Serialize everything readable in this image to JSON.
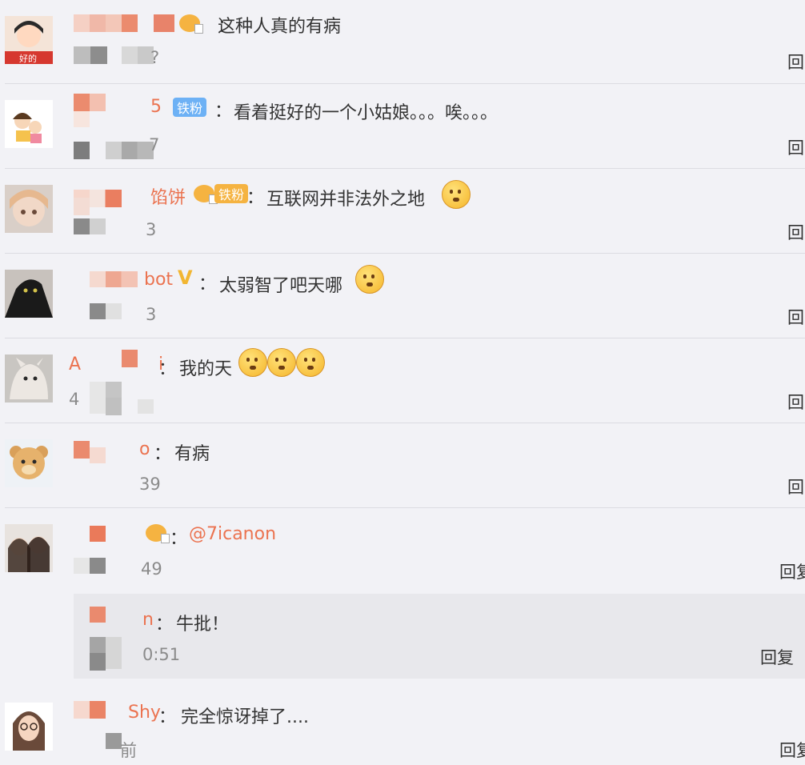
{
  "comments": [
    {
      "name_visible": "",
      "badge": "crown",
      "content": "这种人真的有病",
      "time": "?",
      "reply": "回"
    },
    {
      "name_visible": "5",
      "badge": "铁粉",
      "content": "看着挺好的一个小姑娘。。。唉。。。",
      "time": "7",
      "reply": "回"
    },
    {
      "name_visible": "馅饼",
      "badge": "铁粉",
      "content": "互联网并非法外之地",
      "time": "3",
      "reply": "回"
    },
    {
      "name_visible": "bot",
      "badge": "V",
      "content": "太弱智了吧天哪",
      "time": "3",
      "reply": "回"
    },
    {
      "name_visible": "A i",
      "badge": "",
      "content": "我的天",
      "time": "4",
      "reply": "回"
    },
    {
      "name_visible": "o",
      "badge": "",
      "content": "有病",
      "time": "39",
      "reply": "回"
    },
    {
      "name_visible": "",
      "badge": "crown",
      "content": "@7icanon",
      "time": "49",
      "reply": "回复"
    },
    {
      "name_visible": "n",
      "badge": "",
      "content": "牛批！",
      "time": "0:51",
      "reply": "回复"
    },
    {
      "name_visible": "Shy",
      "badge": "",
      "content": "完全惊讶掉了....",
      "time": "前",
      "reply": "回复"
    }
  ],
  "badges": {
    "fan": "铁粉",
    "v": "V"
  },
  "colors": {
    "name": "#eb7350",
    "fan_badge": "#6db1f5",
    "gold": "#f5b341",
    "bg": "#f2f2f6"
  },
  "icons": [
    "crown-icon",
    "fan-badge-icon",
    "emoji-laugh-icon",
    "emoji-cover-icon",
    "emoji-surprised-icon",
    "verified-v-icon"
  ]
}
